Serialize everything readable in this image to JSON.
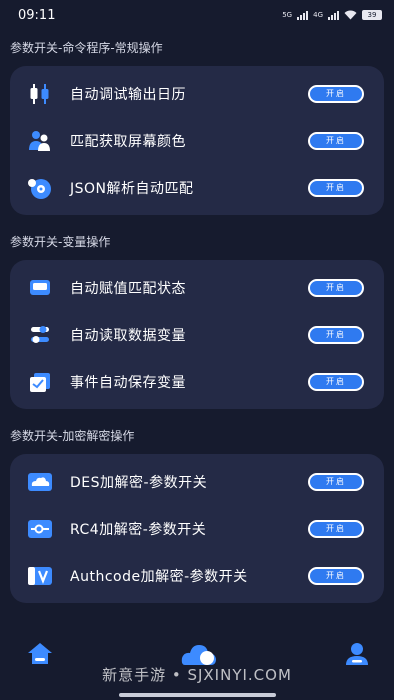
{
  "status": {
    "time": "09:11",
    "net1": "5G",
    "net2": "4G",
    "battery": "39"
  },
  "sections": [
    {
      "title": "参数开关-命令程序-常规操作",
      "items": [
        {
          "label": "自动调试输出日历",
          "toggle": "开启",
          "icon": "candlestick-icon"
        },
        {
          "label": "匹配获取屏幕颜色",
          "toggle": "开启",
          "icon": "users-icon"
        },
        {
          "label": "JSON解析自动匹配",
          "toggle": "开启",
          "icon": "disc-icon"
        }
      ]
    },
    {
      "title": "参数开关-变量操作",
      "items": [
        {
          "label": "自动赋值匹配状态",
          "toggle": "开启",
          "icon": "card-icon"
        },
        {
          "label": "自动读取数据变量",
          "toggle": "开启",
          "icon": "sliders-icon"
        },
        {
          "label": "事件自动保存变量",
          "toggle": "开启",
          "icon": "checkbox-icon"
        }
      ]
    },
    {
      "title": "参数开关-加密解密操作",
      "items": [
        {
          "label": "DES加解密-参数开关",
          "toggle": "开启",
          "icon": "cloud-window-icon"
        },
        {
          "label": "RC4加解密-参数开关",
          "toggle": "开启",
          "icon": "slider-window-icon"
        },
        {
          "label": "Authcode加解密-参数开关",
          "toggle": "开启",
          "icon": "v-window-icon"
        }
      ]
    }
  ],
  "watermark": "新意手游 • SJXINYI.COM",
  "colors": {
    "background": "#161b2e",
    "card": "#242a46",
    "accent": "#2f7af0",
    "icon_blue": "#3d8bff"
  }
}
